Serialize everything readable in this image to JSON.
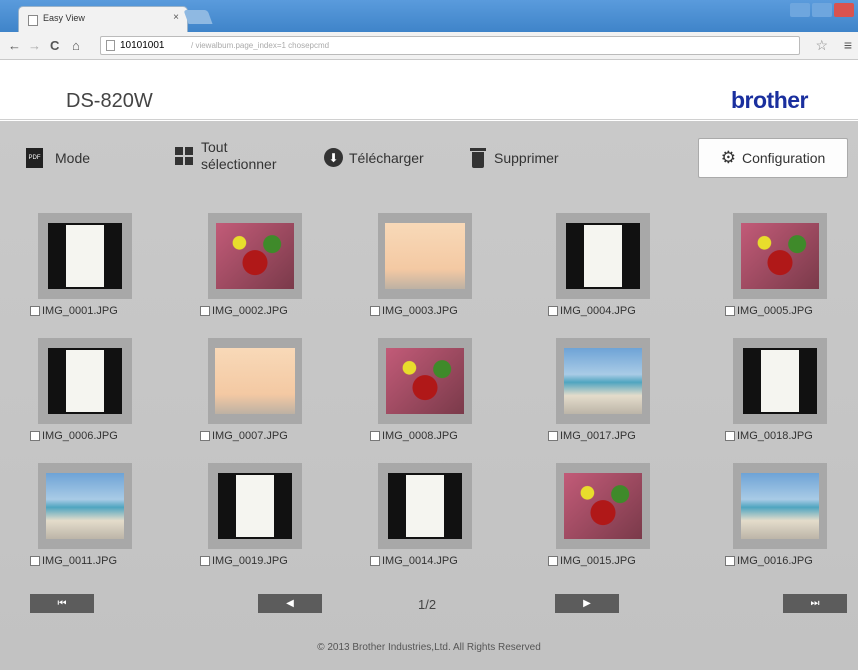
{
  "browser": {
    "tab_title": "Easy View",
    "tab_close": "×",
    "url_host": "10101001",
    "url_path": "/ viewalbum.page_index=1 chosepcmd",
    "back": "←",
    "forward": "→",
    "reload": "C",
    "home": "⌂",
    "star": "☆",
    "menu": "≡"
  },
  "header": {
    "model": "DS-820W",
    "brand": "brother"
  },
  "toolbar": {
    "mode_label": "Mode",
    "select_all_label_line1": "Tout",
    "select_all_label_line2": "sélectionner",
    "download_label": "Télécharger",
    "delete_label": "Supprimer",
    "config_label": "Configuration",
    "pdf_icon_text": "PDF"
  },
  "thumbnails": [
    {
      "name": "IMG_0001.JPG",
      "kind": "doc"
    },
    {
      "name": "IMG_0002.JPG",
      "kind": "food"
    },
    {
      "name": "IMG_0003.JPG",
      "kind": "sunset"
    },
    {
      "name": "IMG_0004.JPG",
      "kind": "doc"
    },
    {
      "name": "IMG_0005.JPG",
      "kind": "food"
    },
    {
      "name": "IMG_0006.JPG",
      "kind": "doc"
    },
    {
      "name": "IMG_0007.JPG",
      "kind": "sunset"
    },
    {
      "name": "IMG_0008.JPG",
      "kind": "food"
    },
    {
      "name": "IMG_0017.JPG",
      "kind": "beach"
    },
    {
      "name": "IMG_0018.JPG",
      "kind": "doc"
    },
    {
      "name": "IMG_0011.JPG",
      "kind": "beach"
    },
    {
      "name": "IMG_0019.JPG",
      "kind": "doc"
    },
    {
      "name": "IMG_0014.JPG",
      "kind": "doc"
    },
    {
      "name": "IMG_0015.JPG",
      "kind": "food"
    },
    {
      "name": "IMG_0016.JPG",
      "kind": "beach"
    }
  ],
  "pager": {
    "first": "⏮",
    "prev": "◀",
    "next": "▶",
    "last": "⏭",
    "page": "1/2"
  },
  "footer": "© 2013 Brother Industries,Ltd. All Rights Reserved",
  "colors": {
    "brand": "#1a2f9e",
    "background": "#c6c6c6",
    "pager_button": "#5c5c5c"
  }
}
